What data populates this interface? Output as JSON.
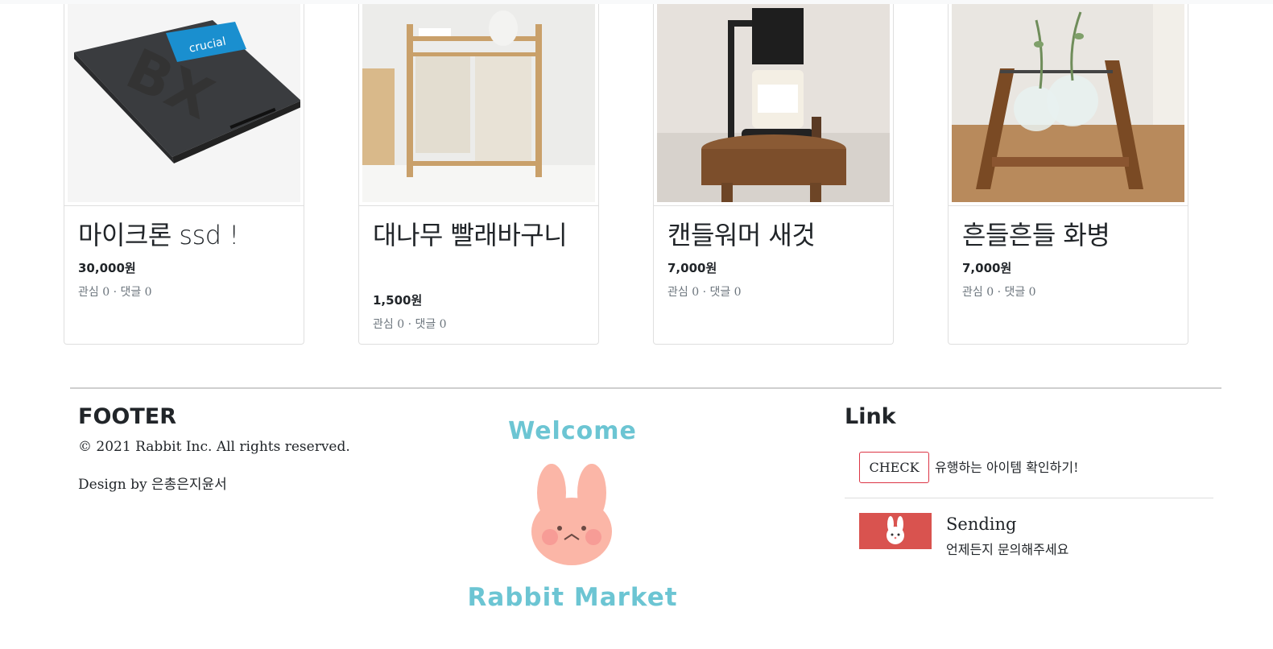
{
  "products": [
    {
      "title": "마이크론 ssd !",
      "price": "30,000원",
      "meta": "관심 0 · 댓글 0",
      "image_icon": "ssd-drive-image"
    },
    {
      "title": "대나무 빨래바구니",
      "price": "1,500원",
      "meta": "관심 0 · 댓글 0",
      "image_icon": "laundry-basket-image"
    },
    {
      "title": "캔들워머 새것",
      "price": "7,000원",
      "meta": "관심 0 · 댓글 0",
      "image_icon": "candle-warmer-image"
    },
    {
      "title": "흔들흔들 화병",
      "price": "7,000원",
      "meta": "관심 0 · 댓글 0",
      "image_icon": "swing-vase-image"
    }
  ],
  "footer": {
    "title": "FOOTER",
    "copyright": "© 2021 Rabbit Inc. All rights reserved.",
    "design": "Design by 은총은지윤서"
  },
  "logo": {
    "welcome": "Welcome",
    "name": "Rabbit Market",
    "brand_color": "#6cc5d3",
    "icon": "rabbit-face-icon"
  },
  "links": {
    "title": "Link",
    "check_button": "CHECK",
    "check_text": "유행하는 아이템 확인하기!",
    "sending_title": "Sending",
    "sending_sub": "언제든지 문의해주세요",
    "accent_color": "#d9534f"
  }
}
